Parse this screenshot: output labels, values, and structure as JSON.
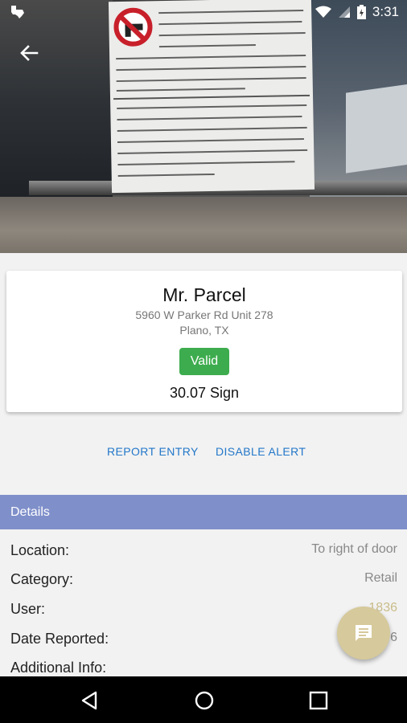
{
  "status_bar": {
    "time": "3:31",
    "app_icon": "texas-icon",
    "icons": [
      "wifi-icon",
      "signal-icon",
      "battery-icon"
    ]
  },
  "header": {
    "image_icon": "sign-photo",
    "back_icon": "back-arrow-icon"
  },
  "location": {
    "name": "Mr. Parcel",
    "address": "5960 W Parker Rd Unit 278",
    "city": "Plano, TX",
    "status": "Valid",
    "sign_type": "30.07 Sign"
  },
  "actions": {
    "report_label": "REPORT ENTRY",
    "disable_label": "DISABLE ALERT"
  },
  "details": {
    "title": "Details",
    "rows": [
      {
        "label": "Location:",
        "value": "To right of door"
      },
      {
        "label": "Category:",
        "value": "Retail"
      },
      {
        "label": "User:",
        "value": "1836"
      },
      {
        "label": "Date Reported:",
        "value": "6"
      },
      {
        "label": "Additional Info:",
        "value": ""
      }
    ]
  },
  "fab": {
    "icon": "chat-message-icon"
  },
  "nav_bar": {
    "icons": [
      "nav-back-icon",
      "nav-home-icon",
      "nav-recents-icon"
    ]
  },
  "colors": {
    "accent_blue": "#2277c9",
    "valid_green": "#3dac4e",
    "section_header": "#7f8fca",
    "fab": "#d6c99b"
  }
}
